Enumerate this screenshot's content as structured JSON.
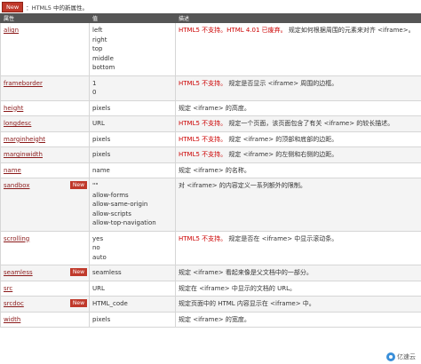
{
  "note": {
    "badge": "New",
    "text": "：HTML5 中的新属性。"
  },
  "headers": [
    "属性",
    "值",
    "描述"
  ],
  "rows": [
    {
      "attr": "align",
      "is_new": false,
      "values": [
        "left",
        "right",
        "top",
        "middle",
        "bottom"
      ],
      "desc_red": "HTML5 不支持。HTML 4.01 已废弃。",
      "desc": "规定如何根据周围的元素来对齐 <iframe>。"
    },
    {
      "attr": "frameborder",
      "is_new": false,
      "values": [
        "1",
        "0"
      ],
      "desc_red": "HTML5 不支持。",
      "desc": "规定是否显示 <iframe> 周围的边框。"
    },
    {
      "attr": "height",
      "is_new": false,
      "values": [
        "pixels"
      ],
      "desc_red": "",
      "desc": "规定 <iframe> 的高度。"
    },
    {
      "attr": "longdesc",
      "is_new": false,
      "values": [
        "URL"
      ],
      "desc_red": "HTML5 不支持。",
      "desc": "规定一个页面，该页面包含了有关 <iframe> 的较长描述。"
    },
    {
      "attr": "marginheight",
      "is_new": false,
      "values": [
        "pixels"
      ],
      "desc_red": "HTML5 不支持。",
      "desc": "规定 <iframe> 的顶部和底部的边距。"
    },
    {
      "attr": "marginwidth",
      "is_new": false,
      "values": [
        "pixels"
      ],
      "desc_red": "HTML5 不支持。",
      "desc": "规定 <iframe> 的左侧和右侧的边距。"
    },
    {
      "attr": "name",
      "is_new": false,
      "values": [
        "name"
      ],
      "desc_red": "",
      "desc": "规定 <iframe> 的名称。"
    },
    {
      "attr": "sandbox",
      "is_new": true,
      "values": [
        "\"\"",
        "allow-forms",
        "allow-same-origin",
        "allow-scripts",
        "allow-top-navigation"
      ],
      "desc_red": "",
      "desc": "对 <iframe> 的内容定义一系列额外的限制。"
    },
    {
      "attr": "scrolling",
      "is_new": false,
      "values": [
        "yes",
        "no",
        "auto"
      ],
      "desc_red": "HTML5 不支持。",
      "desc": "规定是否在 <iframe> 中显示滚动条。"
    },
    {
      "attr": "seamless",
      "is_new": true,
      "values": [
        "seamless"
      ],
      "desc_red": "",
      "desc": "规定 <iframe> 看起来像是父文档中的一部分。"
    },
    {
      "attr": "src",
      "is_new": false,
      "values": [
        "URL"
      ],
      "desc_red": "",
      "desc": "规定在 <iframe> 中显示的文档的 URL。"
    },
    {
      "attr": "srcdoc",
      "is_new": true,
      "values": [
        "HTML_code"
      ],
      "desc_red": "",
      "desc": "规定页面中的 HTML 内容显示在 <iframe> 中。"
    },
    {
      "attr": "width",
      "is_new": false,
      "values": [
        "pixels"
      ],
      "desc_red": "",
      "desc": "规定 <iframe> 的宽度。"
    }
  ],
  "new_badge_label": "New",
  "watermark": "亿速云"
}
